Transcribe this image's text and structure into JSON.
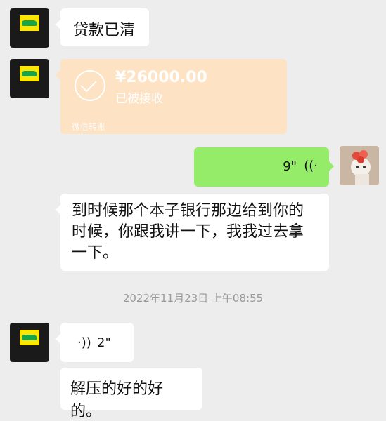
{
  "messages": {
    "msg1": {
      "text": "贷款已清"
    },
    "transfer": {
      "amount": "¥26000.00",
      "status": "已被接收",
      "source": "微信转账"
    },
    "voice_self": {
      "duration": "9\"",
      "icon": "voice-wave-icon"
    },
    "msg2": {
      "text": "到时候那个本子银行那边给到你的时候，你跟我讲一下，我我过去拿一下。"
    },
    "timestamp": "2022年11月23日 上午08:55",
    "voice_other": {
      "duration": "2\"",
      "icon": "voice-wave-icon"
    },
    "msg3": {
      "text": "解压的好的好的。"
    }
  },
  "colors": {
    "background": "#ededed",
    "self_bubble": "#95ec69",
    "transfer_card": "#fde2c4",
    "other_avatar_tile": "#ffe600"
  }
}
